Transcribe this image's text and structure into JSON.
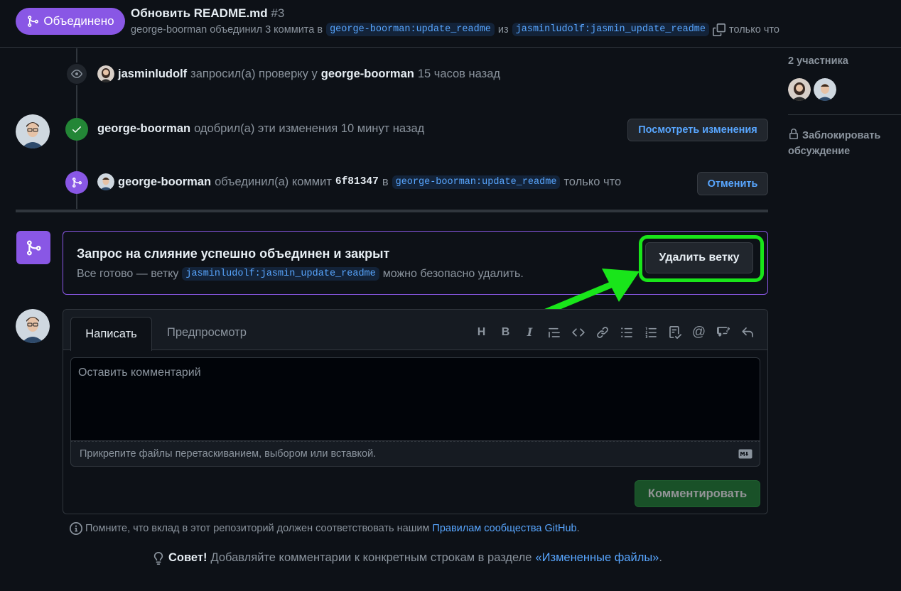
{
  "header": {
    "status_badge": "Объединено",
    "title": "Обновить README.md",
    "number": "#3",
    "sub_prefix": "george-boorman объединил 3 коммита в",
    "head_branch": "george-boorman:update_readme",
    "from_word": "из",
    "base_branch": "jasminludolf:jasmin_update_readme",
    "time": "только что"
  },
  "timeline": {
    "review_request": {
      "user": "jasminludolf",
      "action": "запросил(а) проверку у",
      "reviewer": "george-boorman",
      "time": "15 часов назад"
    },
    "approval": {
      "user": "george-boorman",
      "action": "одобрил(а) эти изменения 10 минут назад",
      "button": "Посмотреть изменения"
    },
    "merge": {
      "user": "george-boorman",
      "action": "объединил(а) коммит",
      "commit": "6f81347",
      "in_word": "в",
      "branch": "george-boorman:update_readme",
      "time": "только что",
      "button": "Отменить"
    }
  },
  "merge_box": {
    "title": "Запрос на слияние успешно объединен и закрыт",
    "sub_prefix": "Все готово — ветку",
    "branch": "jasminludolf:jasmin_update_readme",
    "sub_suffix": "можно безопасно удалить.",
    "delete_button": "Удалить ветку"
  },
  "comment": {
    "tab_write": "Написать",
    "tab_preview": "Предпросмотр",
    "placeholder": "Оставить комментарий",
    "attach_hint": "Прикрепите файлы перетаскиванием, выбором или вставкой.",
    "submit_button": "Комментировать",
    "toolbar_icons": [
      "heading-icon",
      "bold-icon",
      "italic-icon",
      "quote-icon",
      "code-icon",
      "link-icon",
      "bulleted-list-icon",
      "numbered-list-icon",
      "task-list-icon",
      "mention-icon",
      "cross-reference-icon",
      "undo-icon"
    ]
  },
  "footer": {
    "note_prefix": "Помните, что вклад в этот репозиторий должен соответствовать нашим",
    "note_link": "Правилам сообщества GitHub",
    "note_suffix": ".",
    "tip_label": "Совет!",
    "tip_text": "Добавляйте комментарии к конкретным строкам в разделе",
    "tip_link": "«Измененные файлы»",
    "tip_suffix": "."
  },
  "sidebar": {
    "participants_title": "2 участника",
    "lock_label": "Заблокировать обсуждение"
  },
  "colors": {
    "merged": "#8957e5",
    "approved": "#238636",
    "highlight": "#19e51a",
    "link": "#58a6ff"
  }
}
